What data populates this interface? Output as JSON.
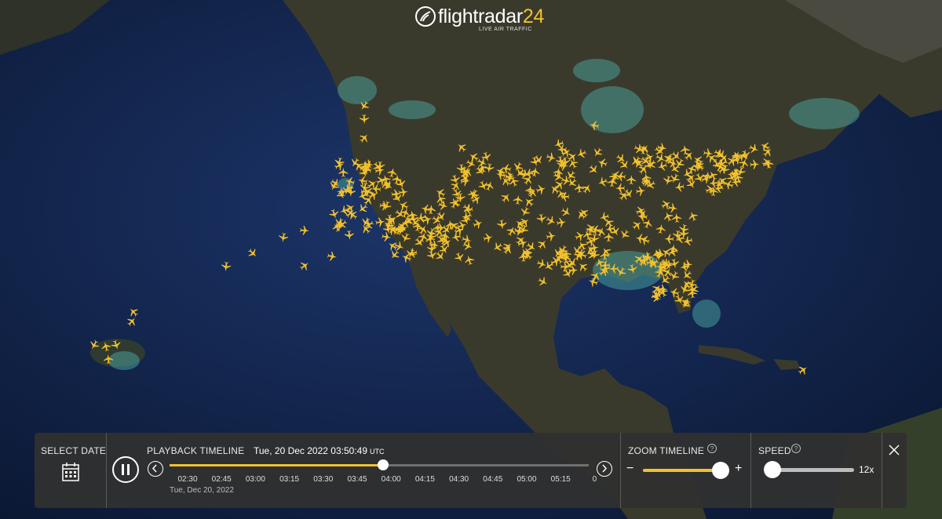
{
  "brand": {
    "name_text": "flightradar",
    "name_num": "24",
    "tagline": "LIVE AIR TRAFFIC"
  },
  "panel": {
    "select_date": {
      "label": "SELECT DATE",
      "icon": "calendar-icon"
    },
    "playback": {
      "label": "PLAYBACK TIMELINE",
      "current_datetime": "Tue, 20 Dec 2022 03:50:49",
      "timezone": "UTC",
      "date_label": "Tue, Dec 20, 2022",
      "ticks": [
        "02:30",
        "02:45",
        "03:00",
        "03:15",
        "03:30",
        "03:45",
        "04:00",
        "04:15",
        "04:30",
        "04:45",
        "05:00",
        "05:15",
        "0"
      ],
      "progress_fraction": 0.51
    },
    "zoom": {
      "label": "ZOOM TIMELINE",
      "minus": "−",
      "plus": "+",
      "level_fraction": 0.9
    },
    "speed": {
      "label": "SPEED",
      "value": "12x",
      "level_fraction": 0.0
    }
  },
  "colors": {
    "accent": "#f2c12e",
    "panel_bg": "#303030",
    "ocean": "#142a55",
    "land": "#3c3a30"
  },
  "map": {
    "icon": "plane-icon"
  }
}
